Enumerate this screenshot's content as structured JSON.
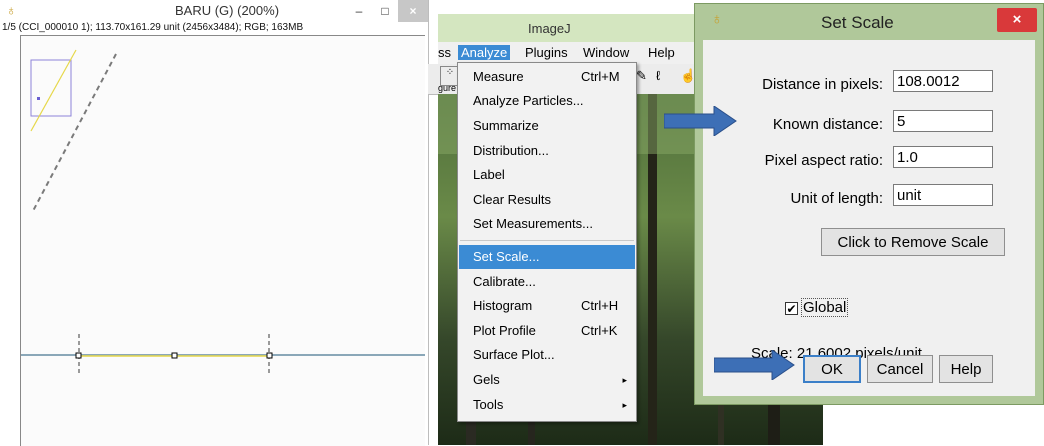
{
  "image_window": {
    "title": "BARU (G) (200%)",
    "info": "1/5 (CCI_000010 1); 113.70x161.29 unit (2456x3484); RGB; 163MB",
    "min_glyph": "–",
    "max_glyph": "□",
    "close_glyph": "×"
  },
  "imagej": {
    "title": "ImageJ",
    "menus": {
      "process_partial": "ss",
      "analyze": "Analyze",
      "plugins": "Plugins",
      "window": "Window",
      "help": "Help"
    },
    "toolbar_partial": "gure"
  },
  "analyze_menu": {
    "items": [
      {
        "label": "Measure",
        "shortcut": "Ctrl+M"
      },
      {
        "label": "Analyze Particles...",
        "shortcut": ""
      },
      {
        "label": "Summarize",
        "shortcut": ""
      },
      {
        "label": "Distribution...",
        "shortcut": ""
      },
      {
        "label": "Label",
        "shortcut": ""
      },
      {
        "label": "Clear Results",
        "shortcut": ""
      },
      {
        "label": "Set Measurements...",
        "shortcut": ""
      },
      {
        "label": "Set Scale...",
        "shortcut": "",
        "highlighted": true
      },
      {
        "label": "Calibrate...",
        "shortcut": ""
      },
      {
        "label": "Histogram",
        "shortcut": "Ctrl+H"
      },
      {
        "label": "Plot Profile",
        "shortcut": "Ctrl+K"
      },
      {
        "label": "Surface Plot...",
        "shortcut": ""
      },
      {
        "label": "Gels",
        "shortcut": "",
        "submenu": true
      },
      {
        "label": "Tools",
        "shortcut": "",
        "submenu": true
      }
    ],
    "submenu_glyph": "▸"
  },
  "set_scale_dialog": {
    "title": "Set Scale",
    "close_glyph": "×",
    "fields": {
      "distance_pixels": {
        "label": "Distance in pixels:",
        "value": "108.0012"
      },
      "known_distance": {
        "label": "Known distance:",
        "value": "5"
      },
      "aspect_ratio": {
        "label": "Pixel aspect ratio:",
        "value": "1.0"
      },
      "unit": {
        "label": "Unit of length:",
        "value": "unit"
      }
    },
    "remove_scale_label": "Click to Remove Scale",
    "global_label": "Global",
    "global_checked": true,
    "check_glyph": "✔",
    "scale_text": "Scale: 21.6002 pixels/unit",
    "ok_label": "OK",
    "cancel_label": "Cancel",
    "help_label": "Help"
  },
  "colors": {
    "menu_highlight": "#3b8bd4",
    "dialog_frame": "#b0c89a",
    "close_red": "#d9393a",
    "annotation_arrow": "#3d6fb6",
    "scale_line": "#e6d84a"
  },
  "icons": [
    "imagej-icon",
    "minimize-icon",
    "maximize-icon",
    "close-icon",
    "checkbox-icon",
    "submenu-arrow-icon",
    "annotation-arrow"
  ]
}
